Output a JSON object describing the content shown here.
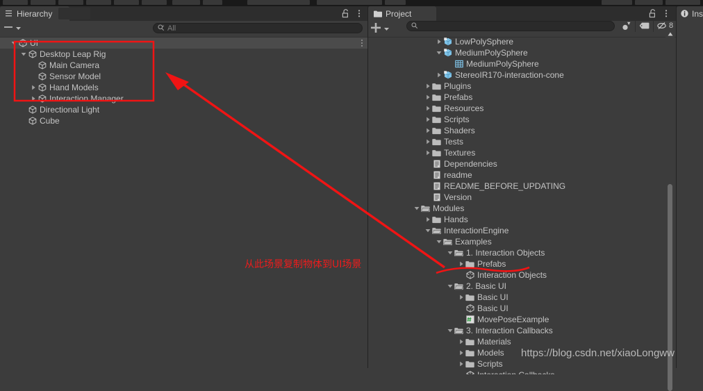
{
  "window": {
    "toolbar_buttons": [
      "tool-hand",
      "tool-move",
      "tool-rotate",
      "tool-scale",
      "tool-rect",
      "tool-transform",
      "tool-pivot",
      "tool-center",
      "tool-play-group",
      "tool-collab",
      "tool-cloud",
      "tool-account",
      "tool-layers",
      "tool-layout"
    ]
  },
  "hierarchy": {
    "tab_label": "Hierarchy",
    "tab_icon": "hierarchy-icon",
    "lock_icon": "lock-open-icon",
    "menu_icon": "kebab-menu-icon",
    "create_label": "",
    "create_dropdown_icon": "chevron-down-icon",
    "search": {
      "placeholder": "All",
      "value": "",
      "icon": "search-icon"
    },
    "rows": [
      {
        "label": "UI",
        "depth": 0,
        "icon": "unity-scene-icon",
        "arrow": "expanded",
        "selected": true,
        "menu": "kebab-menu-icon"
      },
      {
        "label": "Desktop Leap Rig",
        "depth": 1,
        "icon": "gameobject-cube-icon",
        "arrow": "expanded",
        "selected": false
      },
      {
        "label": "Main Camera",
        "depth": 2,
        "icon": "gameobject-cube-icon",
        "arrow": "none",
        "selected": false
      },
      {
        "label": "Sensor Model",
        "depth": 2,
        "icon": "gameobject-cube-icon",
        "arrow": "none",
        "selected": false
      },
      {
        "label": "Hand Models",
        "depth": 2,
        "icon": "gameobject-cube-icon",
        "arrow": "collapsed",
        "selected": false
      },
      {
        "label": "Interaction Manager",
        "depth": 2,
        "icon": "gameobject-cube-icon",
        "arrow": "collapsed",
        "selected": false
      },
      {
        "label": "Directional Light",
        "depth": 1,
        "icon": "gameobject-cube-icon",
        "arrow": "none",
        "selected": false
      },
      {
        "label": "Cube",
        "depth": 1,
        "icon": "gameobject-cube-icon",
        "arrow": "none",
        "selected": false
      }
    ]
  },
  "project": {
    "tab_label": "Project",
    "tab_icon": "folder-icon",
    "lock_icon": "lock-open-icon",
    "menu_icon": "kebab-menu-icon",
    "create_label": "+",
    "create_dropdown_icon": "chevron-down-icon",
    "search": {
      "placeholder": "",
      "value": "",
      "icon": "search-icon"
    },
    "filter_icons": [
      {
        "name": "filter-by-type-icon",
        "label": ""
      },
      {
        "name": "filter-by-label-icon",
        "label": ""
      },
      {
        "name": "saved-search-icon",
        "label": "8"
      }
    ],
    "scroll_up_arrow": "triangle-up-icon",
    "rows": [
      {
        "label": "LowPolySphere",
        "depth": 3,
        "icon": "prefab-icon",
        "arrow": "collapsed"
      },
      {
        "label": "MediumPolySphere",
        "depth": 3,
        "icon": "prefab-icon",
        "arrow": "expanded"
      },
      {
        "label": "MediumPolySphere",
        "depth": 4,
        "icon": "mesh-icon",
        "arrow": "none"
      },
      {
        "label": "StereoIR170-interaction-cone",
        "depth": 3,
        "icon": "prefab-icon",
        "arrow": "collapsed"
      },
      {
        "label": "Plugins",
        "depth": 2,
        "icon": "folder-closed-icon",
        "arrow": "collapsed"
      },
      {
        "label": "Prefabs",
        "depth": 2,
        "icon": "folder-closed-icon",
        "arrow": "collapsed"
      },
      {
        "label": "Resources",
        "depth": 2,
        "icon": "folder-closed-icon",
        "arrow": "collapsed"
      },
      {
        "label": "Scripts",
        "depth": 2,
        "icon": "folder-closed-icon",
        "arrow": "collapsed"
      },
      {
        "label": "Shaders",
        "depth": 2,
        "icon": "folder-closed-icon",
        "arrow": "collapsed"
      },
      {
        "label": "Tests",
        "depth": 2,
        "icon": "folder-closed-icon",
        "arrow": "collapsed"
      },
      {
        "label": "Textures",
        "depth": 2,
        "icon": "folder-closed-icon",
        "arrow": "collapsed"
      },
      {
        "label": "Dependencies",
        "depth": 2,
        "icon": "text-file-icon",
        "arrow": "none"
      },
      {
        "label": "readme",
        "depth": 2,
        "icon": "text-file-icon",
        "arrow": "none"
      },
      {
        "label": "README_BEFORE_UPDATING",
        "depth": 2,
        "icon": "text-file-icon",
        "arrow": "none"
      },
      {
        "label": "Version",
        "depth": 2,
        "icon": "text-file-icon",
        "arrow": "none"
      },
      {
        "label": "Modules",
        "depth": 1,
        "icon": "folder-open-icon",
        "arrow": "expanded"
      },
      {
        "label": "Hands",
        "depth": 2,
        "icon": "folder-closed-icon",
        "arrow": "collapsed"
      },
      {
        "label": "InteractionEngine",
        "depth": 2,
        "icon": "folder-open-icon",
        "arrow": "expanded"
      },
      {
        "label": "Examples",
        "depth": 3,
        "icon": "folder-open-icon",
        "arrow": "expanded"
      },
      {
        "label": "1. Interaction Objects",
        "depth": 4,
        "icon": "folder-open-icon",
        "arrow": "expanded"
      },
      {
        "label": "Prefabs",
        "depth": 5,
        "icon": "folder-closed-icon",
        "arrow": "collapsed"
      },
      {
        "label": "Interaction Objects",
        "depth": 5,
        "icon": "unity-scene-icon",
        "arrow": "none"
      },
      {
        "label": "2. Basic UI",
        "depth": 4,
        "icon": "folder-open-icon",
        "arrow": "expanded"
      },
      {
        "label": "Basic UI",
        "depth": 5,
        "icon": "folder-closed-icon",
        "arrow": "collapsed"
      },
      {
        "label": "Basic UI",
        "depth": 5,
        "icon": "unity-scene-icon",
        "arrow": "none"
      },
      {
        "label": "MovePoseExample",
        "depth": 5,
        "icon": "csharp-script-icon",
        "arrow": "none"
      },
      {
        "label": "3. Interaction Callbacks",
        "depth": 4,
        "icon": "folder-open-icon",
        "arrow": "expanded"
      },
      {
        "label": "Materials",
        "depth": 5,
        "icon": "folder-closed-icon",
        "arrow": "collapsed"
      },
      {
        "label": "Models",
        "depth": 5,
        "icon": "folder-closed-icon",
        "arrow": "collapsed"
      },
      {
        "label": "Scripts",
        "depth": 5,
        "icon": "folder-closed-icon",
        "arrow": "collapsed"
      },
      {
        "label": "Interaction Callbacks",
        "depth": 5,
        "icon": "unity-scene-icon",
        "arrow": "none"
      }
    ]
  },
  "inspector": {
    "tab_label": "Ins",
    "tab_icon": "info-icon"
  },
  "annotations": {
    "note_text": "从此场景复制物体到UI场景",
    "note_color": "#ee1c1c",
    "highlight_box_color": "#f01414",
    "arrow_color": "#f01414",
    "underline_color": "#f01414",
    "watermark": "https://blog.csdn.net/xiaoLongww"
  }
}
